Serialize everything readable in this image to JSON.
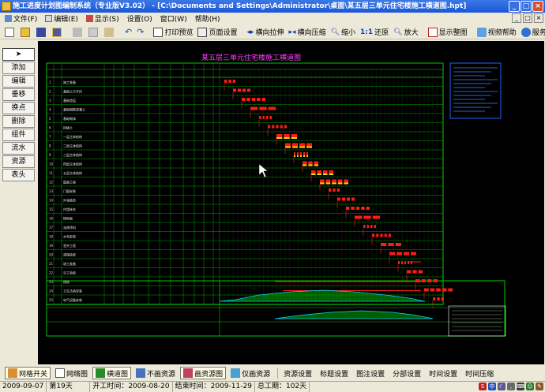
{
  "window": {
    "title": "施工进度计划图编制系统（专业版V3.02） - [C:\\Documents and Settings\\Administrator\\桌面\\某五层三单元住宅楼施工横道图.hpt]"
  },
  "menu": {
    "items": [
      {
        "label": "文件(F)"
      },
      {
        "label": "编辑(E)"
      },
      {
        "label": "显示(S)"
      },
      {
        "label": "设置(O)"
      },
      {
        "label": "窗口(W)"
      },
      {
        "label": "帮助(H)"
      }
    ]
  },
  "toolbar": {
    "print_preview": "打印预览",
    "page_setup": "页面设置",
    "stretch_h": "横向拉伸",
    "compress_h": "横向压缩",
    "zoom_out": "缩小",
    "restore": "还原",
    "zoom_in": "放大",
    "show_all": "显示整图",
    "video_help": "视频帮助",
    "forum": "服务论坛"
  },
  "left_panel": {
    "items": [
      "添加",
      "编辑",
      "垂移",
      "换点",
      "删除",
      "组件",
      "流水",
      "资源",
      "表头"
    ]
  },
  "chart": {
    "title": "某五层三单元住宅楼施工横道图",
    "tasks": [
      "施工准备",
      "基础土方开挖",
      "基础垫层",
      "基础钢筋混凝土",
      "基础砌体",
      "回填土",
      "一层主体结构",
      "二层主体结构",
      "三层主体结构",
      "四层主体结构",
      "五层主体结构",
      "屋面工程",
      "门窗安装",
      "外墙装饰",
      "内墙抹灰",
      "楼地面",
      "油漆涂料",
      "水电安装",
      "室外工程",
      "清理验收",
      "竣工准备",
      "交工验收",
      "保修",
      "卫生洁具安装",
      "电气设备安装"
    ]
  },
  "bottom_toolbar": {
    "grid_toggle": "网格开关",
    "network_view": "网络图",
    "gantt_view": "横道图",
    "no_resource": "不画资源",
    "draw_resource": "画资源图",
    "draw_only_resource": "仅画资源",
    "resource_settings": "资源设置",
    "title_settings": "标题设置",
    "legend_settings": "图注设置",
    "section_settings": "分部设置",
    "time_settings": "时间设置",
    "time_compress": "时间压缩"
  },
  "status": {
    "date": "2009-09-07",
    "day": "第19天",
    "start_label": "开工时间：",
    "start_date": "2009-08-20",
    "end_label": "结束时间：",
    "end_date": "2009-11-29",
    "total_label": "总工期：",
    "total_days": "102天"
  },
  "colors": {
    "title_bar": "#1a56d8",
    "canvas_bg": "#000000",
    "grid_line": "#00c800",
    "bar_red": "#ff1a1a",
    "bar_yellow": "#f0e000",
    "title_magenta": "#ff40ff",
    "resource_cyan": "#00d8ff"
  }
}
